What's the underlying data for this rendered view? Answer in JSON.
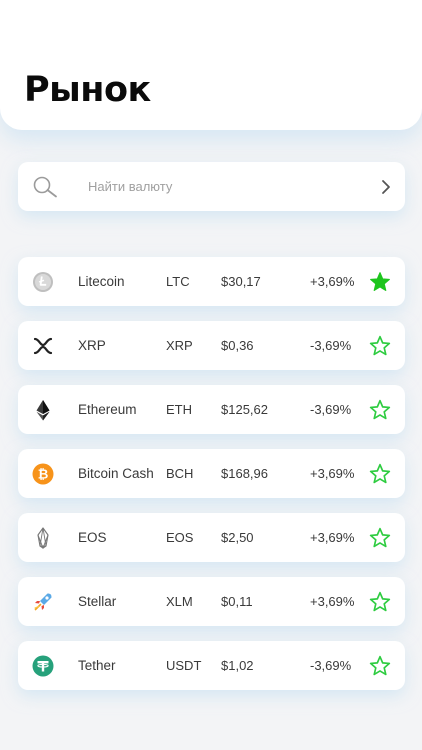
{
  "header": {
    "title": "Рынок"
  },
  "search": {
    "placeholder": "Найти валюту"
  },
  "colors": {
    "accent": "#2ecc40",
    "background": "#f3f4f6"
  },
  "coins": [
    {
      "name": "Litecoin",
      "symbol": "LTC",
      "price": "$30,17",
      "change": "+3,69%",
      "favorite": true,
      "icon": "litecoin-icon"
    },
    {
      "name": "XRP",
      "symbol": "XRP",
      "price": "$0,36",
      "change": "-3,69%",
      "favorite": false,
      "icon": "xrp-icon"
    },
    {
      "name": "Ethereum",
      "symbol": "ETH",
      "price": "$125,62",
      "change": "-3,69%",
      "favorite": false,
      "icon": "ethereum-icon"
    },
    {
      "name": "Bitcoin Cash",
      "symbol": "BCH",
      "price": "$168,96",
      "change": "+3,69%",
      "favorite": false,
      "icon": "bitcoin-cash-icon"
    },
    {
      "name": "EOS",
      "symbol": "EOS",
      "price": "$2,50",
      "change": "+3,69%",
      "favorite": false,
      "icon": "eos-icon"
    },
    {
      "name": "Stellar",
      "symbol": "XLM",
      "price": "$0,11",
      "change": "+3,69%",
      "favorite": false,
      "icon": "stellar-icon"
    },
    {
      "name": "Tether",
      "symbol": "USDT",
      "price": "$1,02",
      "change": "-3,69%",
      "favorite": false,
      "icon": "tether-icon"
    }
  ]
}
